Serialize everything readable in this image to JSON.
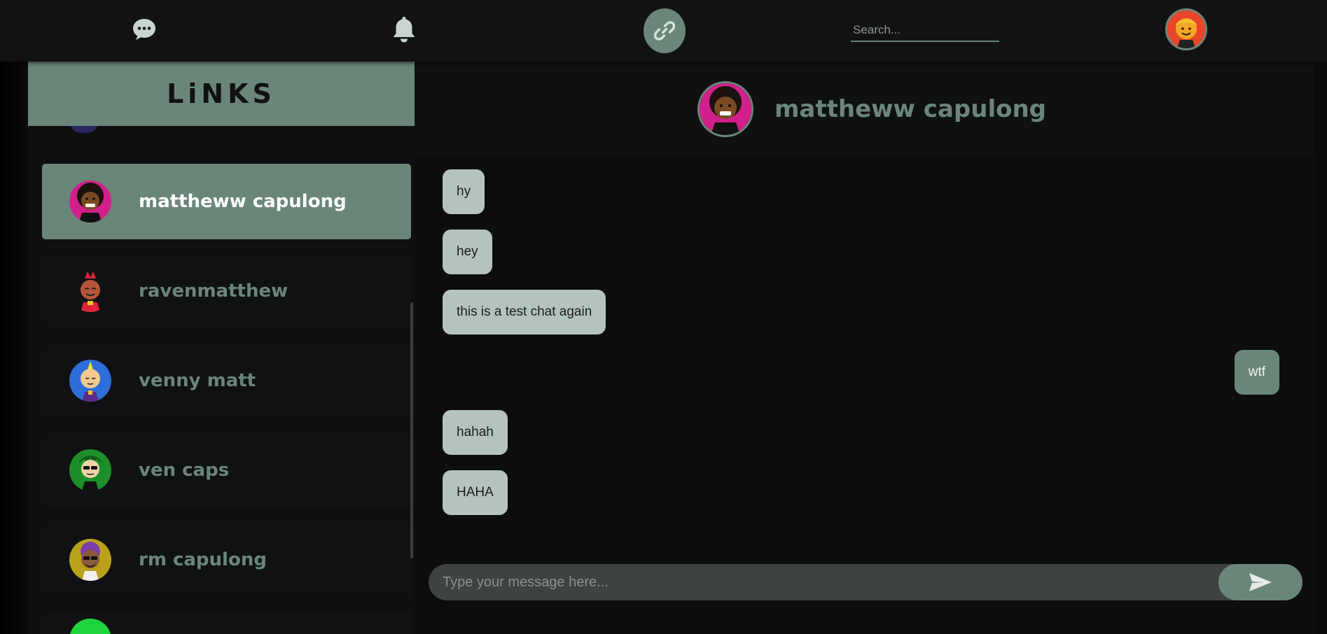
{
  "nav": {
    "icons": [
      "chat-bubble-icon",
      "bell-icon",
      "link-icon"
    ],
    "search_placeholder": "Search...",
    "accent_color": "#6a8679"
  },
  "sidebar": {
    "title": "LiNKS",
    "contacts": [
      {
        "name": "mattheww capulong",
        "active": true
      },
      {
        "name": "ravenmatthew",
        "active": false
      },
      {
        "name": "venny matt",
        "active": false
      },
      {
        "name": "ven caps",
        "active": false
      },
      {
        "name": "rm capulong",
        "active": false
      }
    ]
  },
  "chat": {
    "partner_name": "mattheww capulong",
    "messages": [
      {
        "text": "hy",
        "direction": "received"
      },
      {
        "text": "hey",
        "direction": "received"
      },
      {
        "text": "this is a test chat again",
        "direction": "received"
      },
      {
        "text": "wtf",
        "direction": "sent"
      },
      {
        "text": "hahah",
        "direction": "received"
      },
      {
        "text": "HAHA",
        "direction": "received"
      }
    ],
    "composer_placeholder": "Type your message here..."
  }
}
